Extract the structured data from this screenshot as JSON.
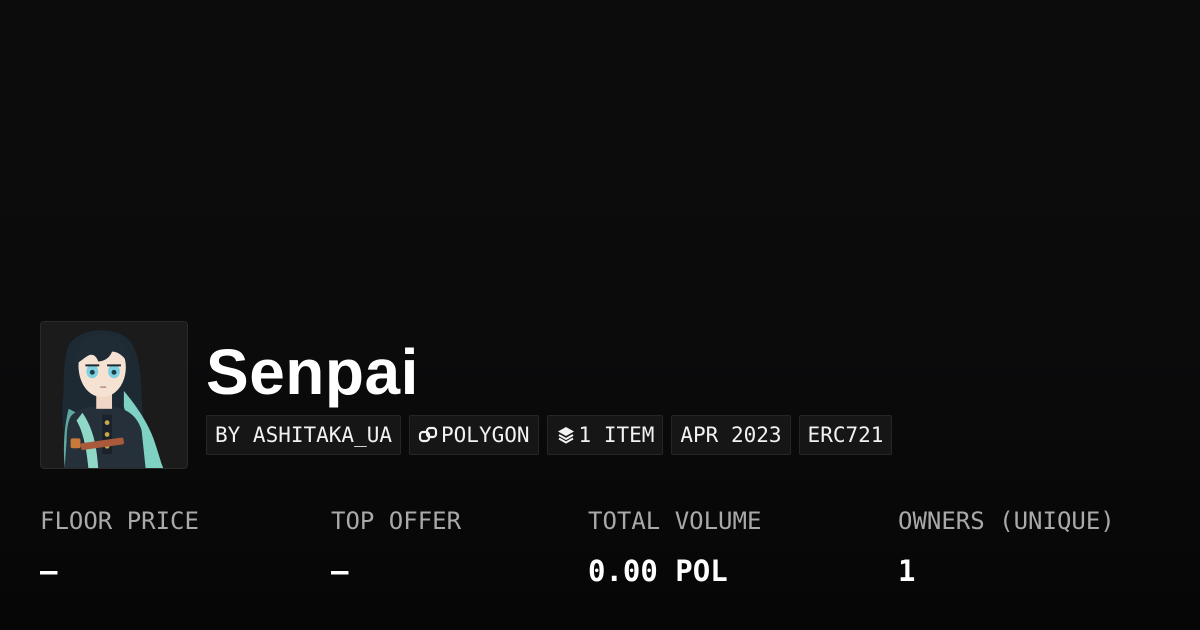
{
  "collection": {
    "title": "Senpai",
    "avatar_icon": "anime-character-avatar"
  },
  "meta": {
    "creator": "BY ASHITAKA_UA",
    "chain": "POLYGON",
    "chain_icon": "polygon-link-icon",
    "items": "1 ITEM",
    "items_icon": "layers-icon",
    "created": "APR 2023",
    "standard": "ERC721"
  },
  "stats": [
    {
      "label": "FLOOR PRICE",
      "value": "–"
    },
    {
      "label": "TOP OFFER",
      "value": "–"
    },
    {
      "label": "TOTAL VOLUME",
      "value": "0.00 POL"
    },
    {
      "label": "OWNERS (UNIQUE)",
      "value": "1"
    }
  ],
  "colors": {
    "background": "#0b0b0c",
    "chip_background": "#161616",
    "label_gray": "#a9a9a9",
    "text": "#ffffff"
  }
}
